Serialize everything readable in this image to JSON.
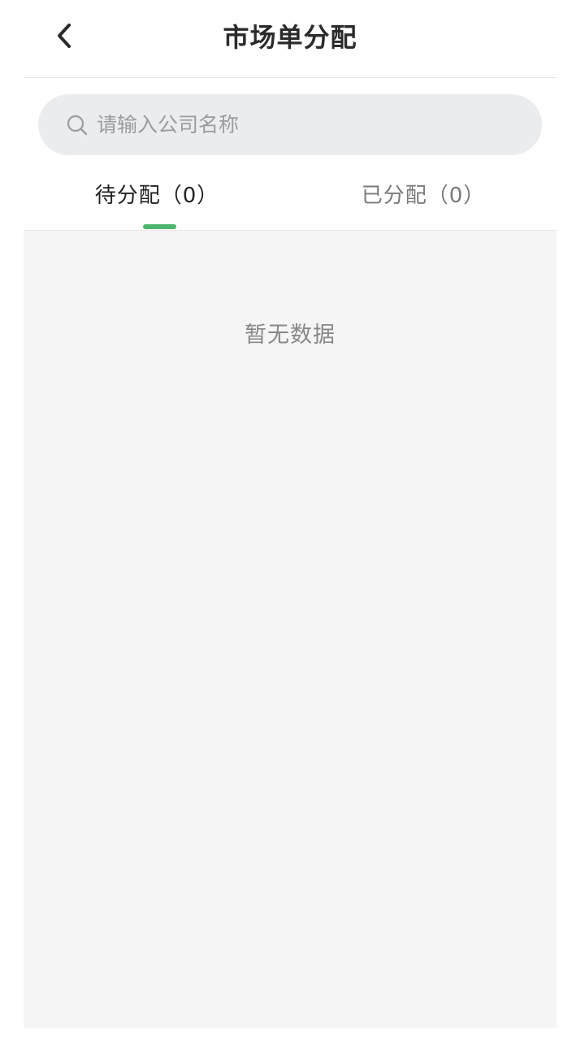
{
  "header": {
    "title": "市场单分配",
    "back_icon": "chevron-left-icon"
  },
  "search": {
    "placeholder": "请输入公司名称",
    "value": "",
    "icon": "search-icon"
  },
  "tabs": {
    "active_index": 0,
    "accent_color": "#4cb56e",
    "items": [
      {
        "label": "待分配（0）"
      },
      {
        "label": "已分配（0）"
      }
    ]
  },
  "content": {
    "empty_text": "暂无数据"
  }
}
